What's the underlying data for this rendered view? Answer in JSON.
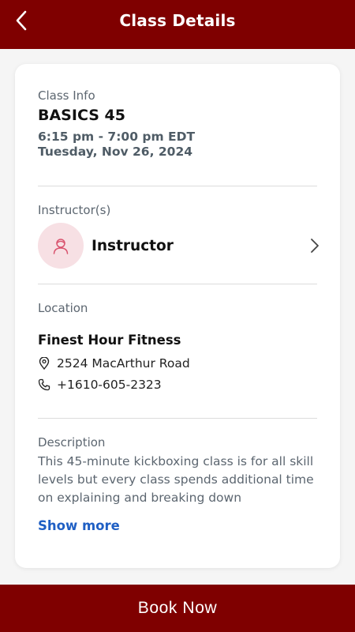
{
  "header": {
    "title": "Class Details",
    "back_icon": "chevron-left-icon"
  },
  "class_info": {
    "label": "Class Info",
    "name": "BASICS 45",
    "time": "6:15 pm - 7:00 pm EDT",
    "date": "Tuesday, Nov 26, 2024"
  },
  "instructor": {
    "label": "Instructor(s)",
    "name": "Instructor",
    "avatar_icon": "person-icon",
    "chevron_icon": "chevron-right-icon"
  },
  "location": {
    "label": "Location",
    "name": "Finest Hour Fitness",
    "address": "2524 MacArthur Road",
    "phone": "+1610-605-2323",
    "address_icon": "map-pin-icon",
    "phone_icon": "phone-icon"
  },
  "description": {
    "label": "Description",
    "text": "This 45-minute kickboxing class is for all skill levels but every class spends additional time on explaining and breaking down technique...",
    "show_more": "Show more"
  },
  "footer": {
    "book_label": "Book Now"
  },
  "colors": {
    "brand": "#7f0000",
    "link": "#1f5fc4",
    "avatar_bg": "#f7e0e4"
  }
}
